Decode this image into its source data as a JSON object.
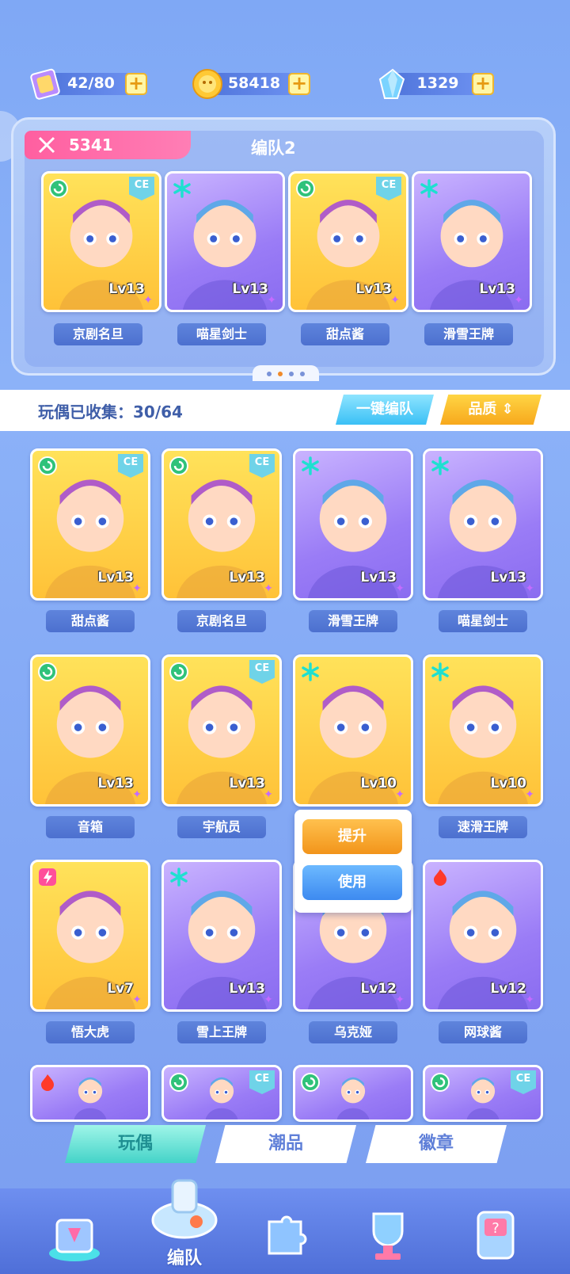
{
  "resources": [
    {
      "name": "ticket",
      "value": "42/80",
      "icon": "ticket-icon"
    },
    {
      "name": "coin",
      "value": "58418",
      "icon": "coin-icon"
    },
    {
      "name": "crystal",
      "value": "1329",
      "icon": "crystal-icon"
    }
  ],
  "plus_label": "+",
  "team": {
    "power": "5341",
    "title": "编队2",
    "members": [
      {
        "name": "京剧名旦",
        "level": "Lv13",
        "rarity": "yellow",
        "element": "swirl",
        "ce": true
      },
      {
        "name": "喵星剑士",
        "level": "Lv13",
        "rarity": "purple",
        "element": "snow",
        "ce": false
      },
      {
        "name": "甜点酱",
        "level": "Lv13",
        "rarity": "yellow",
        "element": "swirl",
        "ce": true
      },
      {
        "name": "滑雪王牌",
        "level": "Lv13",
        "rarity": "purple",
        "element": "snow",
        "ce": false
      }
    ],
    "page_count": 4,
    "page_active": 1
  },
  "collection": {
    "label": "玩偶已收集：30/64",
    "auto_button": "一键编队",
    "quality_button": "品质"
  },
  "dolls": [
    {
      "name": "甜点酱",
      "level": "Lv13",
      "rarity": "yellow",
      "element": "swirl",
      "ce": true
    },
    {
      "name": "京剧名旦",
      "level": "Lv13",
      "rarity": "yellow",
      "element": "swirl",
      "ce": true
    },
    {
      "name": "滑雪王牌",
      "level": "Lv13",
      "rarity": "purple",
      "element": "snow",
      "ce": false
    },
    {
      "name": "喵星剑士",
      "level": "Lv13",
      "rarity": "purple",
      "element": "snow",
      "ce": false
    },
    {
      "name": "音箱",
      "level": "Lv13",
      "rarity": "yellow",
      "element": "swirl",
      "ce": false
    },
    {
      "name": "宇航员",
      "level": "Lv13",
      "rarity": "yellow",
      "element": "swirl",
      "ce": true
    },
    {
      "name": "",
      "level": "Lv10",
      "rarity": "yellow",
      "element": "snow",
      "ce": false
    },
    {
      "name": "速滑王牌",
      "level": "Lv10",
      "rarity": "yellow",
      "element": "snow",
      "ce": false
    },
    {
      "name": "悟大虎",
      "level": "Lv7",
      "rarity": "yellow",
      "element": "bolt",
      "ce": false
    },
    {
      "name": "雪上王牌",
      "level": "Lv13",
      "rarity": "purple",
      "element": "snow",
      "ce": false
    },
    {
      "name": "乌克娅",
      "level": "Lv12",
      "rarity": "purple",
      "element": "none",
      "ce": false
    },
    {
      "name": "网球酱",
      "level": "Lv12",
      "rarity": "purple",
      "element": "fire",
      "ce": false
    },
    {
      "name": "",
      "level": "",
      "rarity": "purple",
      "element": "fire",
      "ce": false
    },
    {
      "name": "",
      "level": "",
      "rarity": "purple",
      "element": "swirl",
      "ce": true
    },
    {
      "name": "",
      "level": "",
      "rarity": "purple",
      "element": "swirl",
      "ce": false
    },
    {
      "name": "",
      "level": "",
      "rarity": "purple",
      "element": "swirl",
      "ce": true
    }
  ],
  "ce_label": "CE",
  "popup": {
    "upgrade": "提升",
    "use": "使用"
  },
  "tabs": [
    {
      "label": "玩偶",
      "active": true
    },
    {
      "label": "潮品",
      "active": false
    },
    {
      "label": "徽章",
      "active": false
    }
  ],
  "bottom_nav": {
    "center_label": "编队",
    "items": [
      "shop-icon",
      "team-whistle-icon",
      "puzzle-icon",
      "trophy-icon",
      "mystery-machine-icon"
    ]
  },
  "colors": {
    "bg": "#84a9f5",
    "power_tag": "#ff6aa8",
    "auto_button": "#3ac0f5",
    "quality_button": "#f7a81c",
    "tab_active": "#44d3c8"
  }
}
